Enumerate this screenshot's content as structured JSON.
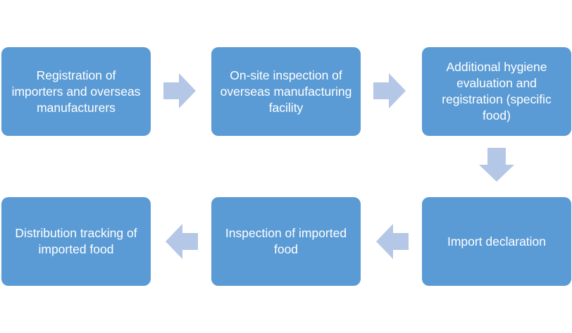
{
  "steps": [
    {
      "label": "Registration of importers and overseas manufacturers"
    },
    {
      "label": "On-site inspection of overseas manufacturing facility"
    },
    {
      "label": "Additional hygiene evaluation and registration (specific food)"
    },
    {
      "label": "Import declaration"
    },
    {
      "label": "Inspection of imported food"
    },
    {
      "label": "Distribution tracking of imported food"
    }
  ],
  "colors": {
    "box_fill": "#5b9bd5",
    "box_text": "#ffffff",
    "arrow_fill": "#b4c7e7",
    "background": "#ffffff"
  },
  "arrow_directions": [
    "right",
    "right",
    "down",
    "left",
    "left"
  ]
}
